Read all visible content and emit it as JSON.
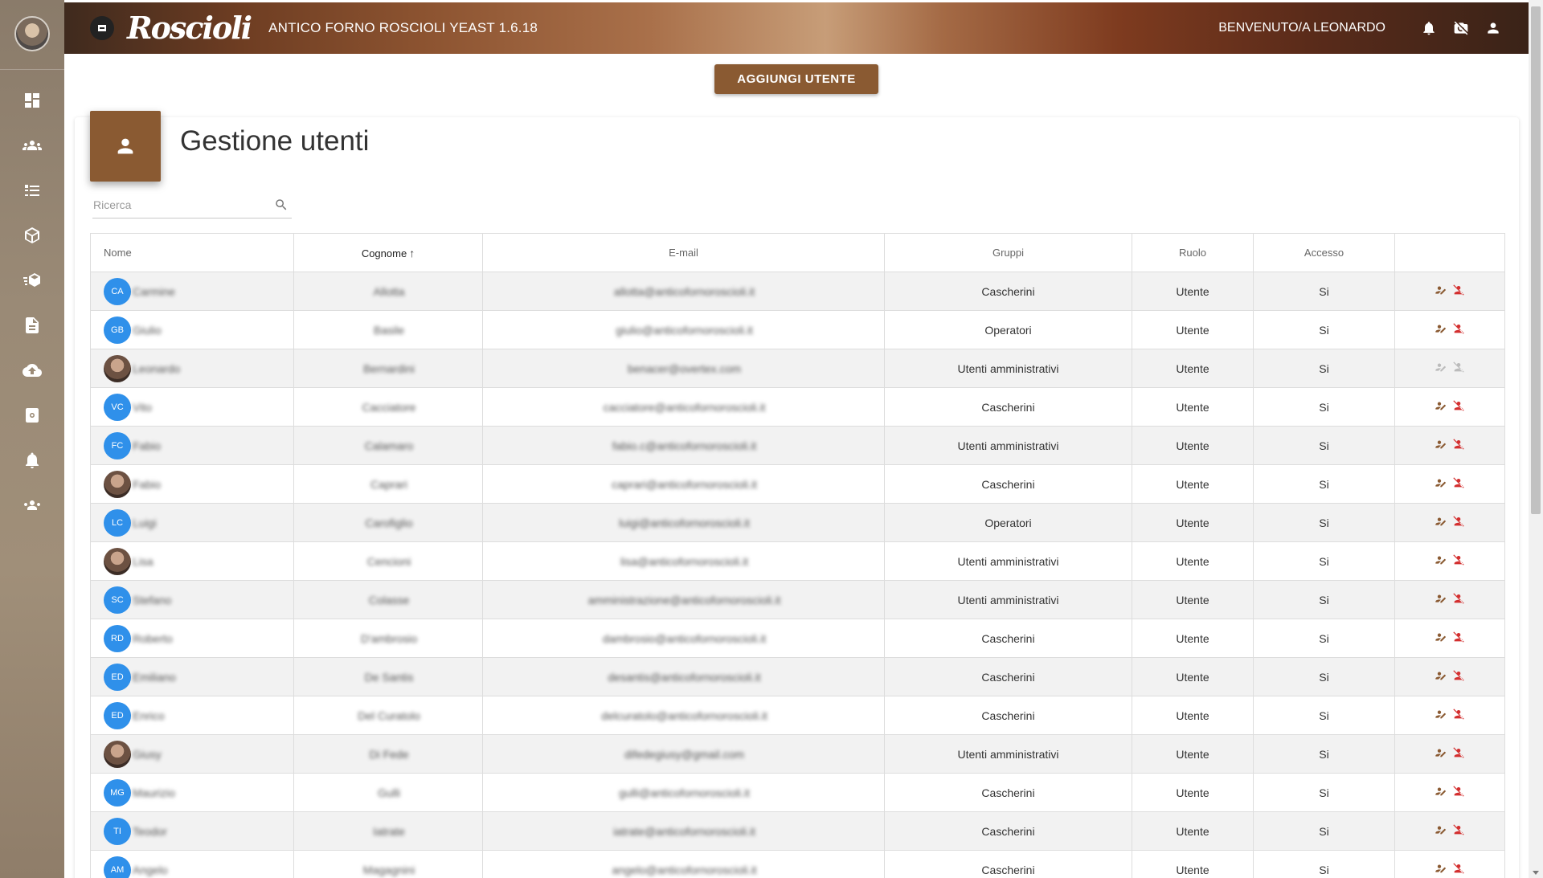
{
  "header": {
    "logo_text": "Roscioli",
    "app_title": "ANTICO FORNO ROSCIOLI YEAST 1.6.18",
    "welcome": "BENVENUTO/A LEONARDO"
  },
  "sidebar": {
    "items": [
      {
        "icon": "dashboard-icon"
      },
      {
        "icon": "groups-icon"
      },
      {
        "icon": "list-icon"
      },
      {
        "icon": "box-icon"
      },
      {
        "icon": "delivery-icon"
      },
      {
        "icon": "document-icon"
      },
      {
        "icon": "cloud-upload-icon"
      },
      {
        "icon": "map-icon"
      },
      {
        "icon": "bell-icon"
      },
      {
        "icon": "users-icon"
      }
    ]
  },
  "toolbar": {
    "add_user_label": "AGGIUNGI UTENTE"
  },
  "page": {
    "title": "Gestione utenti"
  },
  "search": {
    "placeholder": "Ricerca"
  },
  "table": {
    "columns": [
      "Nome",
      "Cognome",
      "E-mail",
      "Gruppi",
      "Ruolo",
      "Accesso",
      ""
    ],
    "sorted_column": "Cognome",
    "rows": [
      {
        "initials": "CA",
        "photo": false,
        "nome": "Carmine",
        "cognome": "Allotta",
        "email": "allotta@anticofornoroscioli.it",
        "gruppi": "Cascherini",
        "ruolo": "Utente",
        "accesso": "Si",
        "actions_enabled": true
      },
      {
        "initials": "GB",
        "photo": false,
        "nome": "Giulio",
        "cognome": "Basile",
        "email": "giulio@anticofornoroscioli.it",
        "gruppi": "Operatori",
        "ruolo": "Utente",
        "accesso": "Si",
        "actions_enabled": true
      },
      {
        "initials": "",
        "photo": true,
        "nome": "Leonardo",
        "cognome": "Bernardini",
        "email": "benacer@overtex.com",
        "gruppi": "Utenti amministrativi",
        "ruolo": "Utente",
        "accesso": "Si",
        "actions_enabled": false
      },
      {
        "initials": "VC",
        "photo": false,
        "nome": "Vito",
        "cognome": "Cacciatore",
        "email": "cacciatore@anticofornoroscioli.it",
        "gruppi": "Cascherini",
        "ruolo": "Utente",
        "accesso": "Si",
        "actions_enabled": true
      },
      {
        "initials": "FC",
        "photo": false,
        "nome": "Fabio",
        "cognome": "Calamaro",
        "email": "fabio.c@anticofornoroscioli.it",
        "gruppi": "Utenti amministrativi",
        "ruolo": "Utente",
        "accesso": "Si",
        "actions_enabled": true
      },
      {
        "initials": "",
        "photo": true,
        "nome": "Fabio",
        "cognome": "Caprari",
        "email": "caprari@anticofornoroscioli.it",
        "gruppi": "Cascherini",
        "ruolo": "Utente",
        "accesso": "Si",
        "actions_enabled": true
      },
      {
        "initials": "LC",
        "photo": false,
        "nome": "Luigi",
        "cognome": "Carofiglio",
        "email": "luigi@anticofornoroscioli.it",
        "gruppi": "Operatori",
        "ruolo": "Utente",
        "accesso": "Si",
        "actions_enabled": true
      },
      {
        "initials": "",
        "photo": true,
        "nome": "Lisa",
        "cognome": "Cencioni",
        "email": "lisa@anticofornoroscioli.it",
        "gruppi": "Utenti amministrativi",
        "ruolo": "Utente",
        "accesso": "Si",
        "actions_enabled": true
      },
      {
        "initials": "SC",
        "photo": false,
        "nome": "Stefano",
        "cognome": "Colasse",
        "email": "amministrazione@anticofornoroscioli.it",
        "gruppi": "Utenti amministrativi",
        "ruolo": "Utente",
        "accesso": "Si",
        "actions_enabled": true
      },
      {
        "initials": "RD",
        "photo": false,
        "nome": "Roberto",
        "cognome": "D'ambrosio",
        "email": "dambrosio@anticofornoroscioli.it",
        "gruppi": "Cascherini",
        "ruolo": "Utente",
        "accesso": "Si",
        "actions_enabled": true
      },
      {
        "initials": "ED",
        "photo": false,
        "nome": "Emiliano",
        "cognome": "De Santis",
        "email": "desantis@anticofornoroscioli.it",
        "gruppi": "Cascherini",
        "ruolo": "Utente",
        "accesso": "Si",
        "actions_enabled": true
      },
      {
        "initials": "ED",
        "photo": false,
        "nome": "Enrico",
        "cognome": "Del Curatolo",
        "email": "delcuratolo@anticofornoroscioli.it",
        "gruppi": "Cascherini",
        "ruolo": "Utente",
        "accesso": "Si",
        "actions_enabled": true
      },
      {
        "initials": "",
        "photo": true,
        "nome": "Giusy",
        "cognome": "Di Fede",
        "email": "difedegiusy@gmail.com",
        "gruppi": "Utenti amministrativi",
        "ruolo": "Utente",
        "accesso": "Si",
        "actions_enabled": true
      },
      {
        "initials": "MG",
        "photo": false,
        "nome": "Maurizio",
        "cognome": "Gulli",
        "email": "gulli@anticofornoroscioli.it",
        "gruppi": "Cascherini",
        "ruolo": "Utente",
        "accesso": "Si",
        "actions_enabled": true
      },
      {
        "initials": "TI",
        "photo": false,
        "nome": "Teodor",
        "cognome": "Iatrate",
        "email": "iatrate@anticofornoroscioli.it",
        "gruppi": "Cascherini",
        "ruolo": "Utente",
        "accesso": "Si",
        "actions_enabled": true
      },
      {
        "initials": "AM",
        "photo": false,
        "nome": "Angelo",
        "cognome": "Magagnini",
        "email": "angelo@anticofornoroscioli.it",
        "gruppi": "Cascherini",
        "ruolo": "Utente",
        "accesso": "Si",
        "actions_enabled": true
      }
    ]
  },
  "colors": {
    "brand": "#8a5a32",
    "action_edit": "#8a5a32",
    "action_delete": "#d32f2f",
    "avatar": "#2f90ea"
  }
}
